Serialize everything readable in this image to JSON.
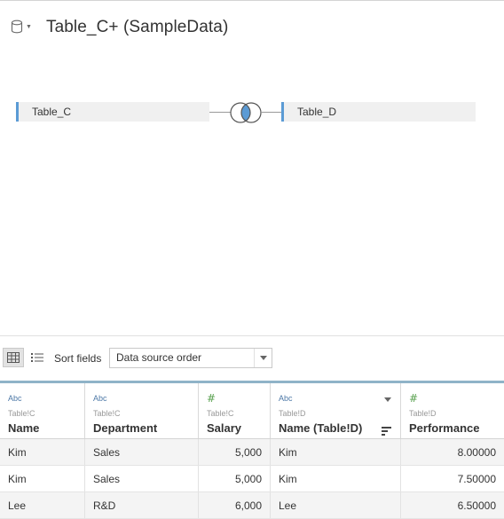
{
  "title": "Table_C+ (SampleData)",
  "join": {
    "left_table": "Table_C",
    "right_table": "Table_D",
    "type_icon": "inner-join-icon"
  },
  "toolbar": {
    "sort_label": "Sort fields",
    "sort_value": "Data source order"
  },
  "colors": {
    "accent": "#5b9bd5",
    "string_type": "#4e79a7",
    "number_type": "#59a14f"
  },
  "grid": {
    "columns": [
      {
        "type_label": "Abc",
        "source": "Table!C",
        "name": "Name"
      },
      {
        "type_label": "Abc",
        "source": "Table!C",
        "name": "Department"
      },
      {
        "type_label": "#",
        "source": "Table!C",
        "name": "Salary"
      },
      {
        "type_label": "Abc",
        "source": "Table!D",
        "name": "Name (Table!D)"
      },
      {
        "type_label": "#",
        "source": "Table!D",
        "name": "Performance"
      }
    ],
    "rows": [
      [
        "Kim",
        "Sales",
        "5,000",
        "Kim",
        "8.00000"
      ],
      [
        "Kim",
        "Sales",
        "5,000",
        "Kim",
        "7.50000"
      ],
      [
        "Lee",
        "R&D",
        "6,000",
        "Lee",
        "6.50000"
      ]
    ]
  }
}
